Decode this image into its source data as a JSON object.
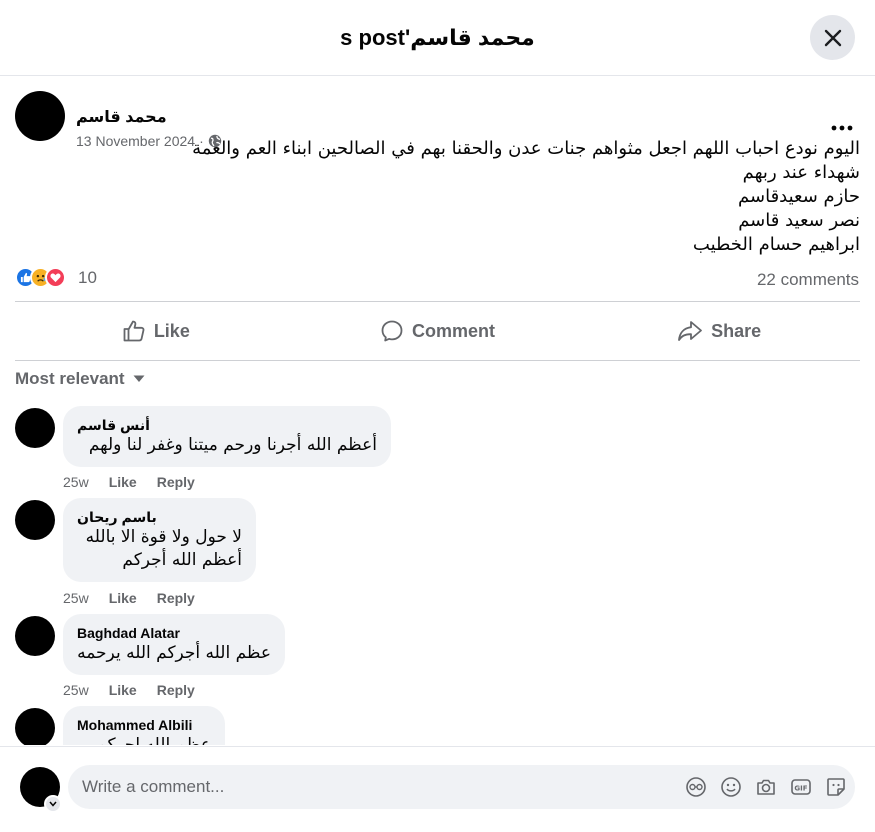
{
  "header": {
    "title": "محمد قاسم's post"
  },
  "post": {
    "author": "محمد قاسم",
    "date": "13 November 2024",
    "visibility_icon": "globe-icon",
    "lines": [
      "اليوم نودع احباب اللهم اجعل مثواهم جنات عدن والحقنا بهم في الصالحين ابناء العم والعمة",
      "شهداء عند ربهم",
      "حازم سعيدقاسم",
      "نصر سعيد قاسم",
      "ابراهيم حسام الخطيب"
    ],
    "reaction_count": "10",
    "comments_count": "22 comments"
  },
  "actions": {
    "like": "Like",
    "comment": "Comment",
    "share": "Share"
  },
  "sort_label": "Most relevant",
  "comments": [
    {
      "name": "أنس قاسم",
      "lines": [
        "أعظم الله أجرنا ورحم ميتنا وغفر لنا ولهم"
      ],
      "time": "25w",
      "like": "Like",
      "reply": "Reply"
    },
    {
      "name": "باسم ريحان",
      "lines": [
        "لا حول ولا قوة الا بالله",
        "أعظم الله أجركم"
      ],
      "time": "25w",
      "like": "Like",
      "reply": "Reply"
    },
    {
      "name": "Baghdad Alatar",
      "lines": [
        "عظم الله أجركم الله يرحمه"
      ],
      "time": "25w",
      "like": "Like",
      "reply": "Reply"
    },
    {
      "name": "Mohammed Albili",
      "lines": [
        "عظم الله اجركم"
      ]
    }
  ],
  "composer": {
    "placeholder": "Write a comment..."
  },
  "colors": {
    "like_blue": "#1b74e4",
    "sad_yellow": "#f7b125",
    "love_red": "#f33e58",
    "bubble_gray": "#f0f2f5",
    "secondary_text": "#65676b"
  }
}
